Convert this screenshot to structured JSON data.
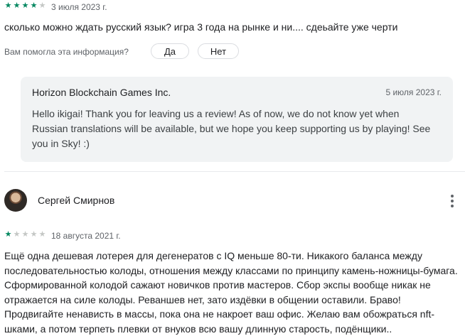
{
  "review1": {
    "rating": 4,
    "date": "3 июля 2023 г.",
    "text": "сколько можно ждать русский язык? игра 3 года на рынке и ни.... сдеьайте уже черти",
    "helpful_question": "Вам помогла эта информация?",
    "yes_label": "Да",
    "no_label": "Нет"
  },
  "reply": {
    "developer": "Horizon Blockchain Games Inc.",
    "date": "5 июля 2023 г.",
    "text": "Hello ikigai! Thank you for leaving us a review! As of now, we do not know yet when Russian translations will be available, but we hope you keep supporting us by playing! See you in Sky! :)"
  },
  "review2": {
    "author": "Сергей Смирнов",
    "rating": 1,
    "date": "18 августа 2021 г.",
    "text": "Ещё одна дешевая лотерея для дегенератов с IQ меньше 80-ти. Никакого баланса между последовательностью колоды, отношения между классами по принципу камень-ножницы-бумага. Сформированной колодой сажают новичков против мастеров. Сбор экспы вообще никак не отражается на силе колоды. Реваншев нет, зато издёвки в общении оставили. Браво! Продвигайте ненависть в массы, пока она не накроет ваш офис. Желаю вам обожраться nft-шками, а потом терпеть плевки от внуков всю вашу длинную старость, подёнщики.."
  },
  "colors": {
    "star_on": "#01875f",
    "star_off": "#c4c7c5"
  },
  "icons": {
    "star": "star-icon",
    "menu": "more-vert-icon"
  }
}
